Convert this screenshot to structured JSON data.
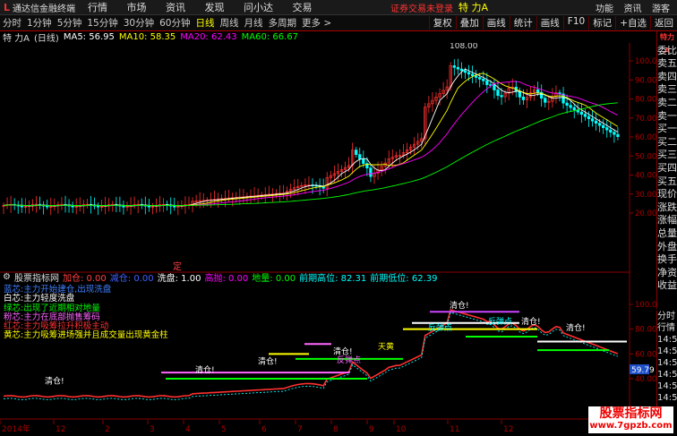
{
  "titlebar": {
    "logo": "L",
    "app_name": "通达信金融终端",
    "menu": [
      "行情",
      "市场",
      "资讯",
      "发现",
      "问小达",
      "交易"
    ],
    "warning": "证券交易未登录",
    "stock_name": "特 力A",
    "right_items": [
      "功能",
      "资讯",
      "游客"
    ]
  },
  "periods": [
    "分时",
    "1分钟",
    "5分钟",
    "15分钟",
    "30分钟",
    "60分钟",
    "日线",
    "周线",
    "月线",
    "多周期",
    "更多 >"
  ],
  "active_period": "日线",
  "tools": [
    "复权",
    "叠加",
    "画线",
    "统计",
    "画线",
    "F10",
    "标记",
    "+自选",
    "返回"
  ],
  "info": {
    "name": "特 力A",
    "period": "(日线)",
    "ma5": "MA5: 56.95",
    "ma10": "MA10: 58.35",
    "ma20": "MA20: 62.43",
    "ma60": "MA60: 66.67",
    "colors": {
      "ma5": "#ffffff",
      "ma10": "#ffff00",
      "ma20": "#ff00ff",
      "ma60": "#00ff00"
    }
  },
  "price_axis": [
    "100.0",
    "90.00",
    "80.00",
    "70.00",
    "60.00",
    "50.00",
    "40.00",
    "30.00",
    "20.00"
  ],
  "price_labels": {
    "high": "108.00",
    "marker": "定"
  },
  "indicator": {
    "name": "股票指标网",
    "fields": [
      {
        "text": "加仓: 0.00",
        "color": "#ff4040"
      },
      {
        "text": "减仓: 0.00",
        "color": "#4060ff"
      },
      {
        "text": "洗盘: 1.00",
        "color": "#ffffff"
      },
      {
        "text": "高抛: 0.00",
        "color": "#ff00ff"
      },
      {
        "text": "地量: 0.00",
        "color": "#00ff00"
      },
      {
        "text": "前期高位: 82.31",
        "color": "#00ffff"
      },
      {
        "text": "前期低位: 62.39",
        "color": "#00ffff"
      }
    ]
  },
  "legend": [
    {
      "text": "蓝芯:主力开始建仓,出现洗盘",
      "color": "#4080ff"
    },
    {
      "text": "白芯:主力轻度洗盘",
      "color": "#ffffff"
    },
    {
      "text": "绿芯:出现了近期相对地量",
      "color": "#00ff00"
    },
    {
      "text": "粉芯:主力在底部抛售筹码",
      "color": "#ff66ff"
    },
    {
      "text": "红芯:主力吸筹拉升积极主动",
      "color": "#ff3030"
    },
    {
      "text": "黄芯:主力吸筹进场强并且成交量出现黄金柱",
      "color": "#ffff00"
    }
  ],
  "indicator_axis": [
    "100.0",
    "80.00",
    "60.00",
    "40.00"
  ],
  "indicator_current": "59.79",
  "annotations": {
    "qingcang": "清仓!",
    "fantan": "反弹点",
    "tianhuang": "天黄",
    "buy": "买"
  },
  "date_axis": [
    "2014年",
    "12",
    "2",
    "3",
    "4",
    "5",
    "6",
    "7",
    "8",
    "9",
    "10",
    "11",
    "12"
  ],
  "side_panel": {
    "header": "特力A",
    "items": [
      "委比",
      "卖五",
      "卖四",
      "卖三",
      "卖二",
      "卖一",
      "买一",
      "买二",
      "买三",
      "买四",
      "买五",
      "现价",
      "涨跌",
      "涨幅",
      "总量",
      "外盘",
      "换手",
      "净资",
      "收益"
    ]
  },
  "time_panel": {
    "header": "分时",
    "sub": "行情",
    "times": [
      "14:56",
      "14:56",
      "14:56",
      "14:56",
      "14:56",
      "14:56",
      "14:56",
      "14:56"
    ]
  },
  "watermark": {
    "big": "股票指标网",
    "small": "www.7gpzb.com"
  }
}
